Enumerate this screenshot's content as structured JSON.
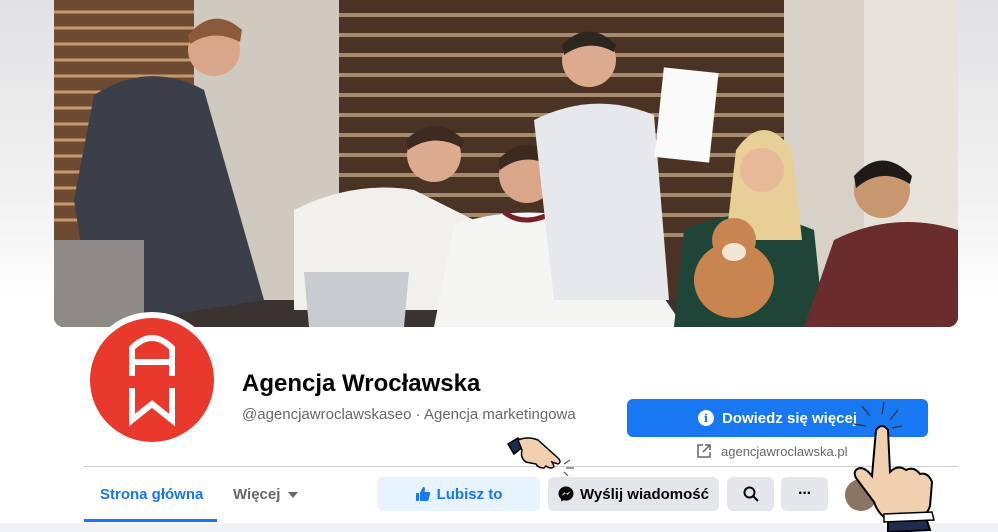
{
  "page": {
    "name": "Agencja Wrocławska",
    "handle_category": "@agencjawroclawskaseo · Agencja marketingowa",
    "logo_letters": "AW"
  },
  "cta": {
    "label": "Dowiedz się więcej",
    "icon": "info-icon"
  },
  "website": {
    "url": "agencjawroclawska.pl",
    "icon": "external-link-icon"
  },
  "tabs": [
    {
      "label": "Strona główna",
      "active": true
    },
    {
      "label": "Więcej",
      "icon": "chevron-down-icon"
    }
  ],
  "actions": {
    "like": {
      "label": "Lubisz to",
      "icon": "thumbs-up-icon"
    },
    "message": {
      "label": "Wyślij wiadomość",
      "icon": "messenger-icon"
    },
    "search": {
      "icon": "search-icon"
    },
    "more": {
      "label": "···",
      "icon": "more-icon"
    }
  },
  "colors": {
    "brand_blue": "#1877f2",
    "logo_red": "#e8392c",
    "secondary_gray": "#e4e6eb"
  }
}
